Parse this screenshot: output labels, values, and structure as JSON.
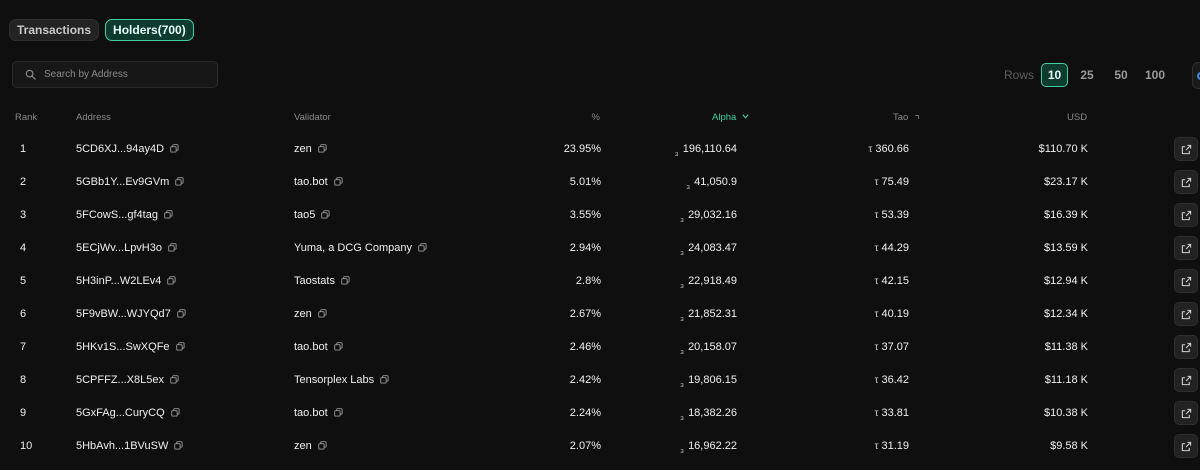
{
  "tabs": [
    {
      "label": "Transactions",
      "active": false
    },
    {
      "label": "Holders(700)",
      "active": true
    }
  ],
  "search": {
    "placeholder": "Search by Address",
    "value": ""
  },
  "rows_selector": {
    "label": "Rows",
    "options": [
      "10",
      "25",
      "50",
      "100"
    ],
    "selected": "10"
  },
  "columns": {
    "rank": "Rank",
    "address": "Address",
    "validator": "Validator",
    "percent": "%",
    "alpha": "Alpha",
    "tao": "Tao",
    "usd": "USD"
  },
  "symbols": {
    "alpha": "₃",
    "tao": "τ"
  },
  "colors": {
    "accent": "#3fcfa2",
    "background": "#0f0f0f"
  },
  "holders": [
    {
      "rank": "1",
      "address": "5CD6XJ...94ay4D",
      "validator": "zen",
      "percent": "23.95%",
      "alpha": "196,110.64",
      "tao": "360.66",
      "usd": "$110.70 K"
    },
    {
      "rank": "2",
      "address": "5GBb1Y...Ev9GVm",
      "validator": "tao.bot",
      "percent": "5.01%",
      "alpha": "41,050.9",
      "tao": "75.49",
      "usd": "$23.17 K"
    },
    {
      "rank": "3",
      "address": "5FCowS...gf4tag",
      "validator": "tao5",
      "percent": "3.55%",
      "alpha": "29,032.16",
      "tao": "53.39",
      "usd": "$16.39 K"
    },
    {
      "rank": "4",
      "address": "5ECjWv...LpvH3o",
      "validator": "Yuma, a DCG Company",
      "percent": "2.94%",
      "alpha": "24,083.47",
      "tao": "44.29",
      "usd": "$13.59 K"
    },
    {
      "rank": "5",
      "address": "5H3inP...W2LEv4",
      "validator": "Taostats",
      "percent": "2.8%",
      "alpha": "22,918.49",
      "tao": "42.15",
      "usd": "$12.94 K"
    },
    {
      "rank": "6",
      "address": "5F9vBW...WJYQd7",
      "validator": "zen",
      "percent": "2.67%",
      "alpha": "21,852.31",
      "tao": "40.19",
      "usd": "$12.34 K"
    },
    {
      "rank": "7",
      "address": "5HKv1S...SwXQFe",
      "validator": "tao.bot",
      "percent": "2.46%",
      "alpha": "20,158.07",
      "tao": "37.07",
      "usd": "$11.38 K"
    },
    {
      "rank": "8",
      "address": "5CPFFZ...X8L5ex",
      "validator": "Tensorplex Labs",
      "percent": "2.42%",
      "alpha": "19,806.15",
      "tao": "36.42",
      "usd": "$11.18 K"
    },
    {
      "rank": "9",
      "address": "5GxFAg...CuryCQ",
      "validator": "tao.bot",
      "percent": "2.24%",
      "alpha": "18,382.26",
      "tao": "33.81",
      "usd": "$10.38 K"
    },
    {
      "rank": "10",
      "address": "5HbAvh...1BVuSW",
      "validator": "zen",
      "percent": "2.07%",
      "alpha": "16,962.22",
      "tao": "31.19",
      "usd": "$9.58 K"
    }
  ]
}
